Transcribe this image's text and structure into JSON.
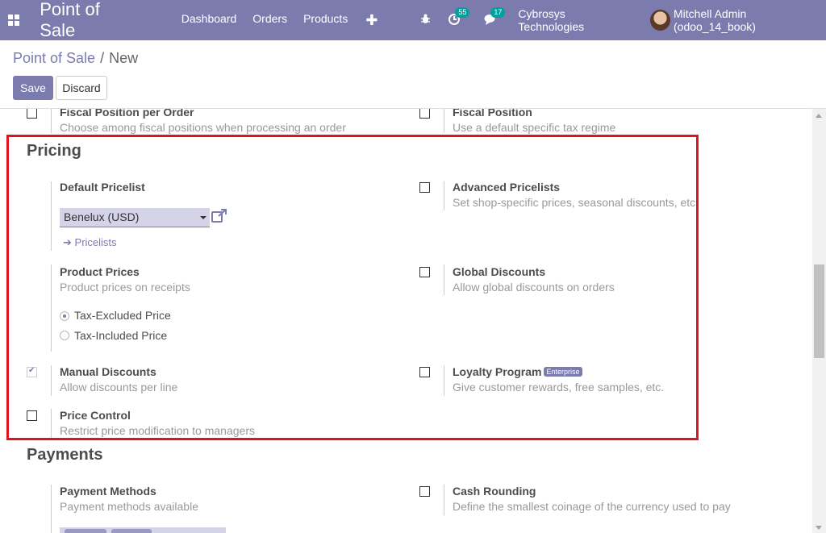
{
  "navbar": {
    "brand": "Point of Sale",
    "menu": [
      "Dashboard",
      "Orders",
      "Products"
    ],
    "plus": "✚",
    "activity_badge": "55",
    "chat_badge": "17",
    "company": "Cybrosys Technologies",
    "user": "Mitchell Admin (odoo_14_book)",
    "accent_color": "#7c7bad"
  },
  "breadcrumb": {
    "parent": "Point of Sale",
    "separator": "/",
    "current": "New"
  },
  "buttons": {
    "save": "Save",
    "discard": "Discard"
  },
  "partial_top": {
    "left_title": "Fiscal Position per Order",
    "left_desc": "Choose among fiscal positions when processing an order",
    "right_title": "Fiscal Position",
    "right_desc": "Use a default specific tax regime"
  },
  "pricing": {
    "heading": "Pricing",
    "default_pricelist": {
      "title": "Default Pricelist",
      "value": "Benelux (USD)",
      "link": "Pricelists"
    },
    "advanced_pricelists": {
      "title": "Advanced Pricelists",
      "desc": "Set shop-specific prices, seasonal discounts, etc.",
      "checked": false
    },
    "product_prices": {
      "title": "Product Prices",
      "desc": "Product prices on receipts",
      "options": [
        "Tax-Excluded Price",
        "Tax-Included Price"
      ],
      "selected": "Tax-Excluded Price"
    },
    "global_discounts": {
      "title": "Global Discounts",
      "desc": "Allow global discounts on orders",
      "checked": false
    },
    "manual_discounts": {
      "title": "Manual Discounts",
      "desc": "Allow discounts per line",
      "checked": true
    },
    "loyalty_program": {
      "title": "Loyalty Program",
      "badge": "Enterprise",
      "desc": "Give customer rewards, free samples, etc.",
      "checked": false
    },
    "price_control": {
      "title": "Price Control",
      "desc": "Restrict price modification to managers",
      "checked": false
    }
  },
  "payments": {
    "heading": "Payments",
    "payment_methods": {
      "title": "Payment Methods",
      "desc": "Payment methods available"
    },
    "cash_rounding": {
      "title": "Cash Rounding",
      "desc": "Define the smallest coinage of the currency used to pay",
      "checked": false
    }
  },
  "highlight_color": "#e0141e"
}
